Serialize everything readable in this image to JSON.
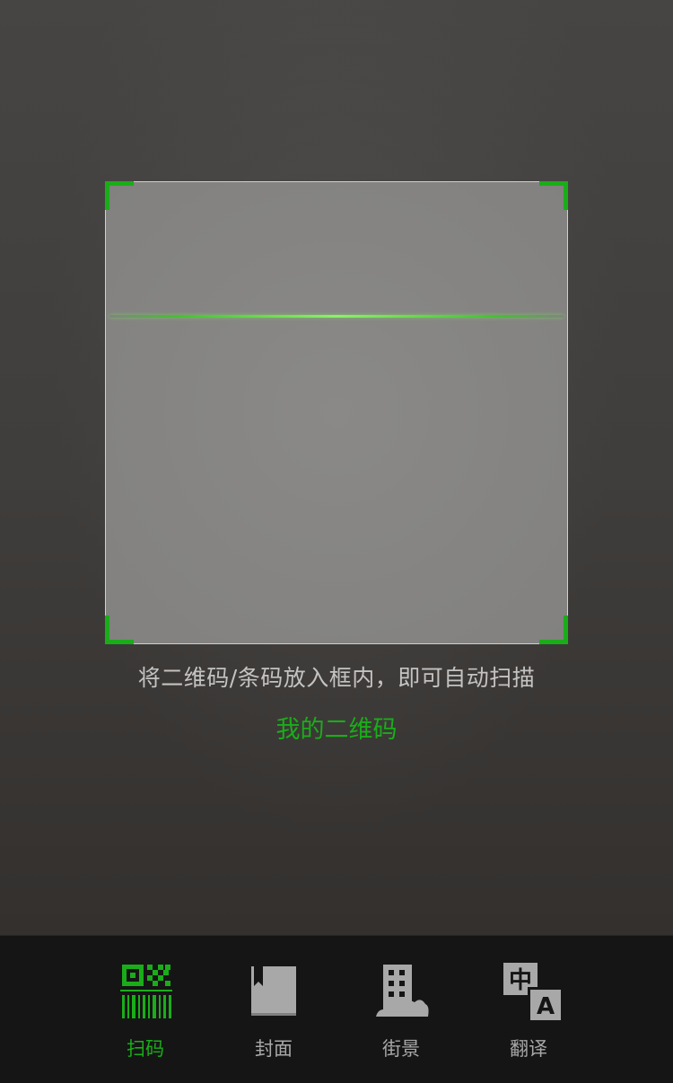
{
  "scanner": {
    "hint": "将二维码/条码放入框内，即可自动扫描",
    "my_qr_label": "我的二维码"
  },
  "tabs": [
    {
      "label": "扫码",
      "icon": "qr-barcode-icon",
      "active": true
    },
    {
      "label": "封面",
      "icon": "book-cover-icon",
      "active": false
    },
    {
      "label": "街景",
      "icon": "building-icon",
      "active": false
    },
    {
      "label": "翻译",
      "icon": "translate-icon",
      "active": false
    }
  ],
  "translate_icon": {
    "source_char": "中",
    "target_char": "A"
  },
  "colors": {
    "accent": "#1aad19",
    "inactive": "#a8a8a8",
    "tab_bar": "#151515"
  }
}
